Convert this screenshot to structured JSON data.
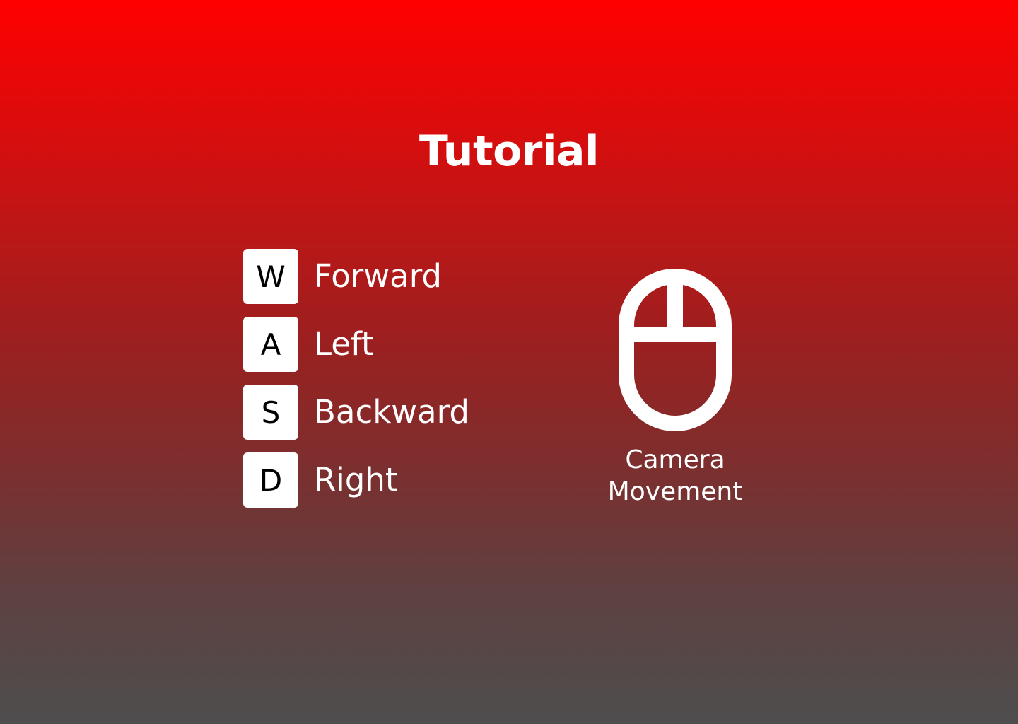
{
  "title": "Tutorial",
  "controls": [
    {
      "key": "W",
      "action": "Forward"
    },
    {
      "key": "A",
      "action": "Left"
    },
    {
      "key": "S",
      "action": "Backward"
    },
    {
      "key": "D",
      "action": "Right"
    }
  ],
  "mouse": {
    "icon": "mouse-icon",
    "label_line1": "Camera",
    "label_line2": "Movement"
  },
  "colors": {
    "gradient_top": "#ff0000",
    "gradient_bottom": "#4e4e4e",
    "key_background": "#ffffff",
    "key_text": "#000000",
    "text": "#ffffff"
  }
}
